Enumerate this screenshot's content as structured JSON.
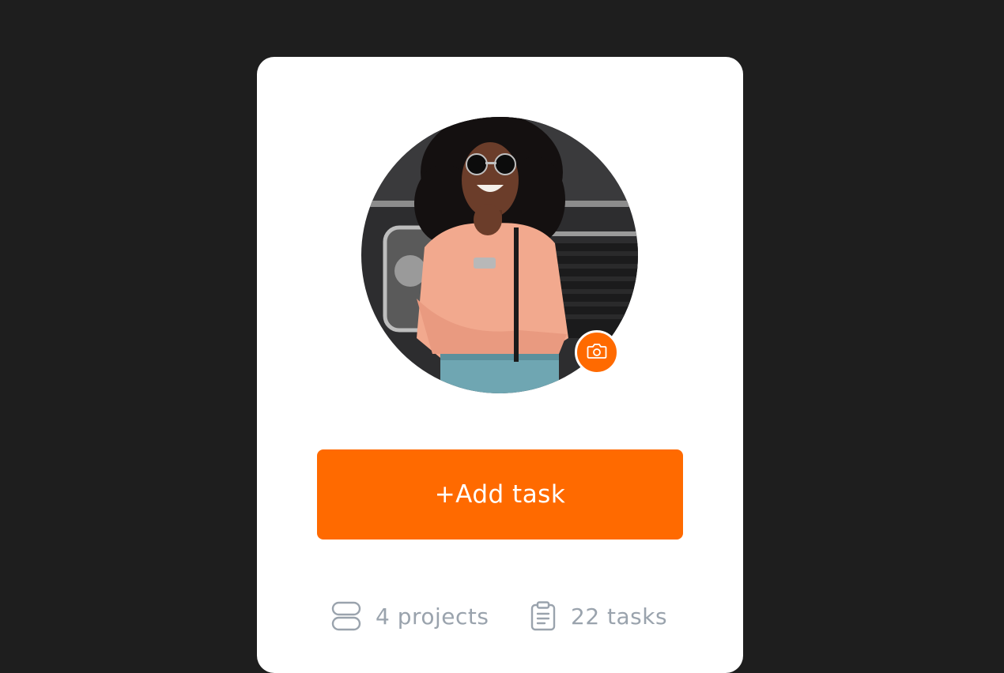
{
  "profile": {
    "avatar_description": "photo-avatar",
    "camera_icon": "camera-icon"
  },
  "actions": {
    "add_task_label": "+Add task"
  },
  "stats": {
    "projects_label": "4 projects",
    "projects_icon": "stack-icon",
    "tasks_label": "22 tasks",
    "tasks_icon": "clipboard-icon"
  },
  "colors": {
    "accent": "#ff6a00",
    "background": "#1e1e1e",
    "card": "#ffffff",
    "muted_text": "#9aa3ad"
  }
}
